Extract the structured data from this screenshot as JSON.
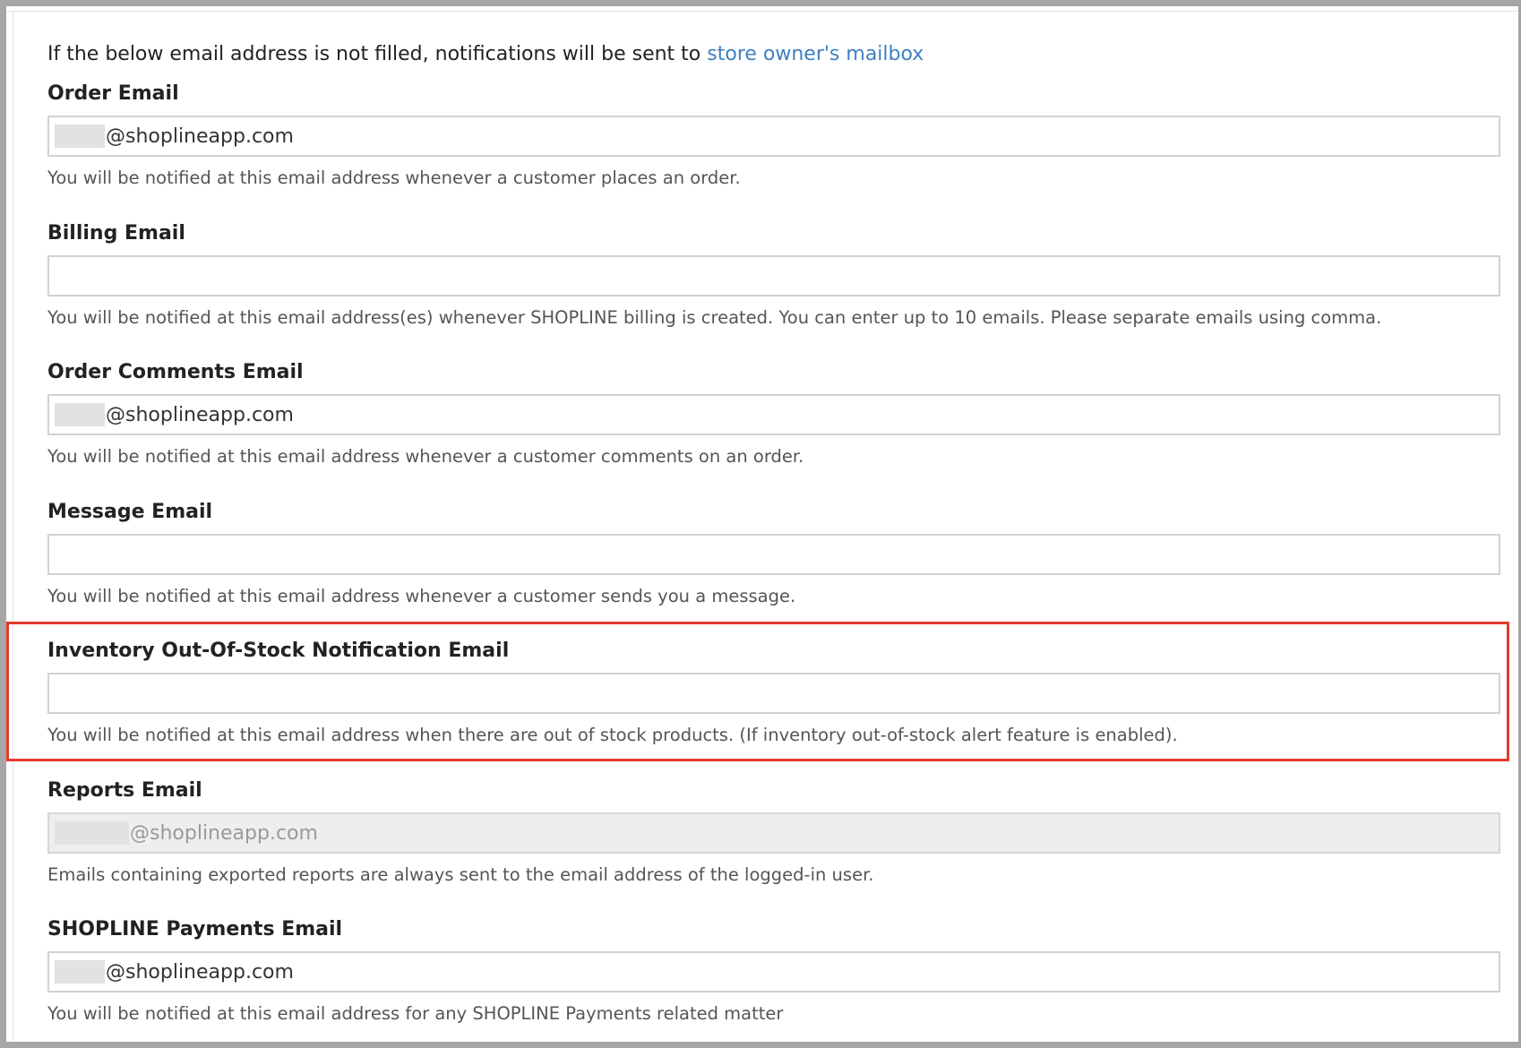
{
  "intro": {
    "text": "If the below email address is not filled, notifications will be sent to ",
    "link_text": "store owner's mailbox"
  },
  "fields": {
    "order": {
      "label": "Order Email",
      "value": "@shoplineapp.com",
      "help": "You will be notified at this email address whenever a customer places an order."
    },
    "billing": {
      "label": "Billing Email",
      "value": "",
      "help": "You will be notified at this email address(es) whenever SHOPLINE billing is created. You can enter up to 10 emails. Please separate emails using comma."
    },
    "order_comments": {
      "label": "Order Comments Email",
      "value": "@shoplineapp.com",
      "help": "You will be notified at this email address whenever a customer comments on an order."
    },
    "message": {
      "label": "Message Email",
      "value": "",
      "help": "You will be notified at this email address whenever a customer sends you a message."
    },
    "inventory": {
      "label": "Inventory Out-Of-Stock Notification Email",
      "value": "",
      "help": "You will be notified at this email address when there are out of stock products. (If inventory out-of-stock alert feature is enabled)."
    },
    "reports": {
      "label": "Reports Email",
      "value": "@shoplineapp.com",
      "help": "Emails containing exported reports are always sent to the email address of the logged-in user."
    },
    "payments": {
      "label": "SHOPLINE Payments Email",
      "value": "@shoplineapp.com",
      "help": "You will be notified at this email address for any SHOPLINE Payments related matter"
    }
  },
  "colors": {
    "link": "#3f80c2",
    "highlight": "#e23a2b",
    "disabled_bg": "#eeeeee"
  }
}
